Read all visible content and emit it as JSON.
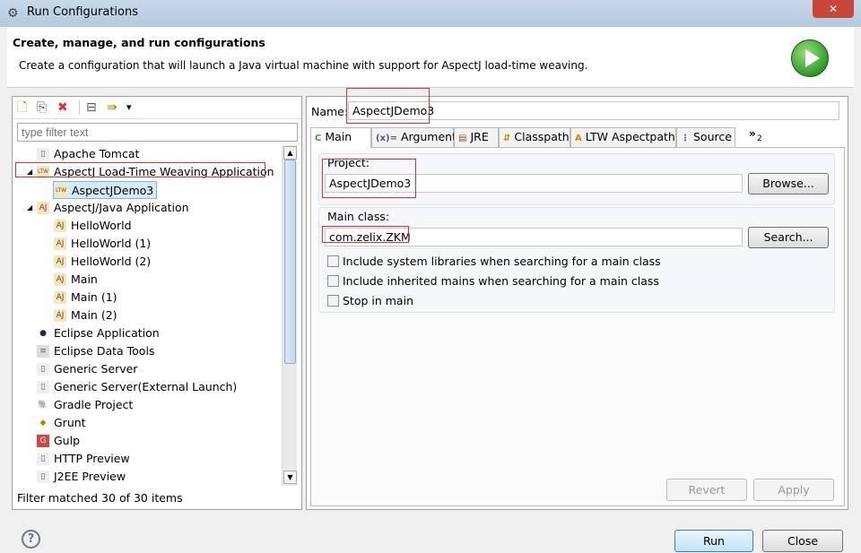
{
  "window": {
    "title": "Run Configurations",
    "close": "✕"
  },
  "header": {
    "title": "Create, manage, and run configurations",
    "description": "Create a configuration that will launch a Java virtual machine with support for AspectJ load-time weaving."
  },
  "left": {
    "toolbar": {
      "new": "🗋",
      "duplicate": "⎘",
      "delete": "✖",
      "collapse": "⊟",
      "filter": "⇛",
      "menu": "▾"
    },
    "filter_placeholder": "type filter text",
    "tree": [
      {
        "label": "Apache Tomcat",
        "level": 0,
        "icon": "server-icon"
      },
      {
        "label": "AspectJ Load-Time Weaving Application",
        "level": 0,
        "icon": "ltw-icon",
        "expanded": true
      },
      {
        "label": "AspectJDemo3",
        "level": 1,
        "icon": "ltw-icon",
        "selected": true
      },
      {
        "label": "AspectJ/Java Application",
        "level": 0,
        "icon": "aj-icon",
        "expanded": true
      },
      {
        "label": "HelloWorld",
        "level": 1,
        "icon": "aj-icon"
      },
      {
        "label": "HelloWorld (1)",
        "level": 1,
        "icon": "aj-icon"
      },
      {
        "label": "HelloWorld (2)",
        "level": 1,
        "icon": "aj-icon"
      },
      {
        "label": "Main",
        "level": 1,
        "icon": "aj-icon"
      },
      {
        "label": "Main (1)",
        "level": 1,
        "icon": "aj-icon"
      },
      {
        "label": "Main (2)",
        "level": 1,
        "icon": "aj-icon"
      },
      {
        "label": "Eclipse Application",
        "level": 0,
        "icon": "eclipse-icon"
      },
      {
        "label": "Eclipse Data Tools",
        "level": 0,
        "icon": "database-icon"
      },
      {
        "label": "Generic Server",
        "level": 0,
        "icon": "server-icon"
      },
      {
        "label": "Generic Server(External Launch)",
        "level": 0,
        "icon": "server-icon"
      },
      {
        "label": "Gradle Project",
        "level": 0,
        "icon": "gradle-icon"
      },
      {
        "label": "Grunt",
        "level": 0,
        "icon": "grunt-icon"
      },
      {
        "label": "Gulp",
        "level": 0,
        "icon": "gulp-icon"
      },
      {
        "label": "HTTP Preview",
        "level": 0,
        "icon": "server-icon"
      },
      {
        "label": "J2EE Preview",
        "level": 0,
        "icon": "server-icon"
      }
    ],
    "status": "Filter matched 30 of 30 items"
  },
  "right": {
    "name_label": "Name:",
    "name_value": "AspectJDemo3",
    "tabs": [
      {
        "label": "Main",
        "icon": "C"
      },
      {
        "label": "Arguments",
        "icon": "(x)="
      },
      {
        "label": "JRE",
        "icon": "▤"
      },
      {
        "label": "Classpath",
        "icon": "⇵"
      },
      {
        "label": "LTW Aspectpath",
        "icon": "A"
      },
      {
        "label": "Source",
        "icon": "⋮"
      }
    ],
    "more_tabs": "»",
    "more_count": "2",
    "project_label": "Project:",
    "project_value": "AspectJDemo3",
    "browse": "Browse...",
    "main_class_label": "Main class:",
    "main_class_value": "com.zelix.ZKM",
    "search": "Search...",
    "checkboxes": [
      {
        "label": "Include system libraries when searching for a main class",
        "checked": false
      },
      {
        "label": "Include inherited mains when searching for a main class",
        "checked": false
      },
      {
        "label": "Stop in main",
        "checked": false
      }
    ],
    "revert": "Revert",
    "apply": "Apply"
  },
  "footer": {
    "help": "?",
    "run": "Run",
    "close": "Close"
  }
}
